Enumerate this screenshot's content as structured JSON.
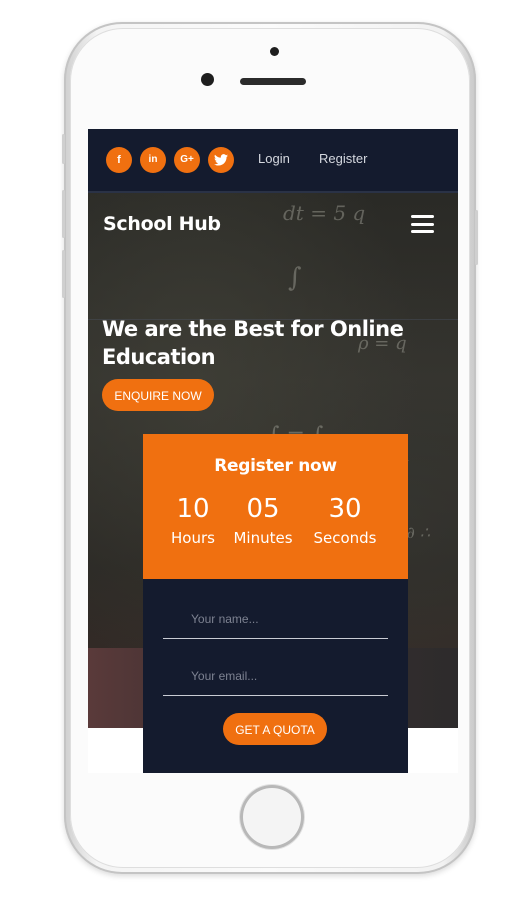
{
  "topbar": {
    "social": [
      {
        "icon": "facebook-icon",
        "glyph": "f"
      },
      {
        "icon": "linkedin-icon",
        "glyph": "in"
      },
      {
        "icon": "google-plus-icon",
        "glyph": "G+"
      },
      {
        "icon": "twitter-icon",
        "glyph": "t"
      }
    ],
    "login_label": "Login",
    "register_label": "Register"
  },
  "nav": {
    "brand": "School Hub",
    "menu_icon": "hamburger-menu-icon"
  },
  "hero": {
    "headline": "We are the Best for Online Education",
    "cta_label": "ENQUIRE NOW"
  },
  "register_card": {
    "title": "Register now",
    "countdown": [
      {
        "value": "10",
        "unit": "Hours"
      },
      {
        "value": "05",
        "unit": "Minutes"
      },
      {
        "value": "30",
        "unit": "Seconds"
      }
    ],
    "name_placeholder": "Your name...",
    "email_placeholder": "Your email...",
    "submit_label": "GET A QUOTA"
  },
  "colors": {
    "accent": "#f07010",
    "dark_navy": "#141b2e"
  }
}
